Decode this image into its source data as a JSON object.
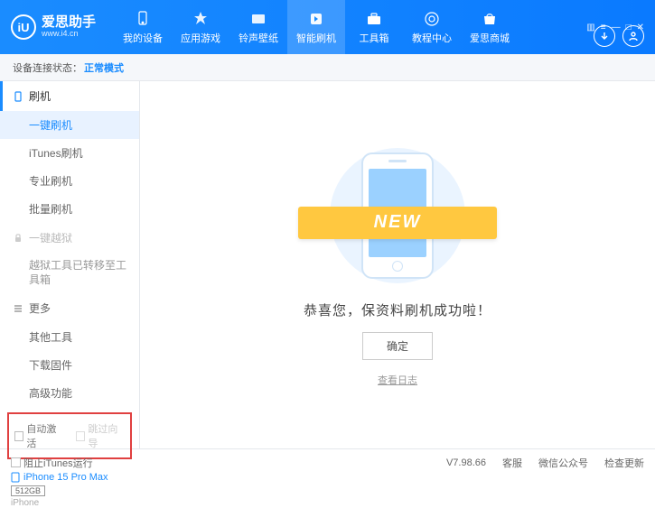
{
  "app": {
    "logo_letter": "iU",
    "title": "爱思助手",
    "url": "www.i4.cn"
  },
  "nav": [
    {
      "label": "我的设备"
    },
    {
      "label": "应用游戏"
    },
    {
      "label": "铃声壁纸"
    },
    {
      "label": "智能刷机"
    },
    {
      "label": "工具箱"
    },
    {
      "label": "教程中心"
    },
    {
      "label": "爱思商城"
    }
  ],
  "status": {
    "label": "设备连接状态：",
    "value": "正常模式"
  },
  "sidebar": {
    "group_flash": "刷机",
    "items_flash": [
      "一键刷机",
      "iTunes刷机",
      "专业刷机",
      "批量刷机"
    ],
    "group_jailbreak": "一键越狱",
    "jailbreak_note": "越狱工具已转移至工具箱",
    "group_more": "更多",
    "items_more": [
      "其他工具",
      "下载固件",
      "高级功能"
    ],
    "checks": {
      "auto_activate": "自动激活",
      "skip_guide": "跳过向导"
    },
    "device": {
      "name": "iPhone 15 Pro Max",
      "storage": "512GB",
      "type": "iPhone"
    }
  },
  "main": {
    "ribbon": "NEW",
    "success": "恭喜您，保资料刷机成功啦！",
    "ok": "确定",
    "view_log": "查看日志"
  },
  "footer": {
    "block_itunes": "阻止iTunes运行",
    "version": "V7.98.66",
    "links": [
      "客服",
      "微信公众号",
      "检查更新"
    ]
  }
}
